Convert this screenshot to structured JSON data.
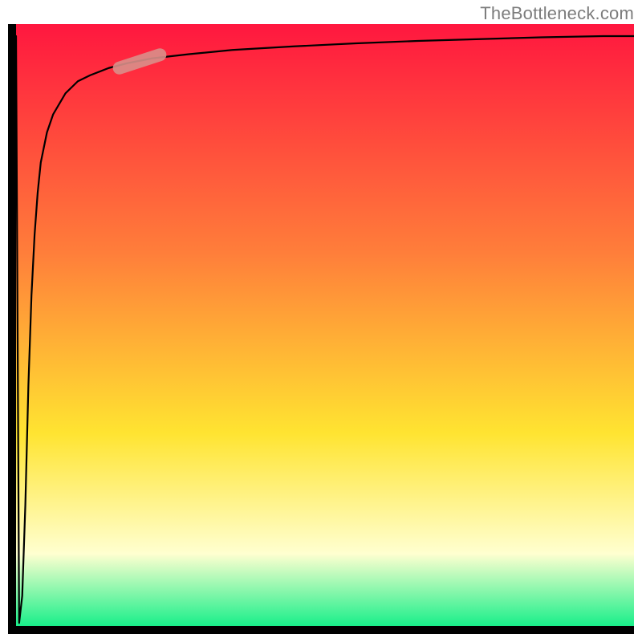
{
  "watermark": "TheBottleneck.com",
  "chart_data": {
    "type": "line",
    "title": "",
    "xlabel": "",
    "ylabel": "",
    "xlim": [
      0,
      100
    ],
    "ylim": [
      0,
      100
    ],
    "grid": false,
    "legend": false,
    "background_gradient": {
      "top": "#ff173f",
      "mid1": "#ff7e3a",
      "mid2": "#ffe431",
      "mid3": "#ffffd0",
      "bottom": "#19ef8a"
    },
    "series": [
      {
        "name": "curve",
        "color": "#000000",
        "stroke_width": 2.2,
        "x": [
          0.0,
          0.5,
          1.0,
          1.5,
          2.0,
          2.5,
          3.0,
          3.5,
          4.0,
          5.0,
          6.0,
          8.0,
          10.0,
          12.0,
          15.0,
          18.0,
          22.0,
          28.0,
          35.0,
          45.0,
          55.0,
          65.0,
          75.0,
          85.0,
          95.0,
          100.0
        ],
        "y": [
          98.0,
          0.5,
          5.0,
          20.0,
          40.0,
          55.0,
          65.0,
          72.0,
          77.0,
          82.0,
          85.0,
          88.5,
          90.5,
          91.5,
          92.7,
          93.5,
          94.3,
          95.0,
          95.7,
          96.3,
          96.8,
          97.2,
          97.5,
          97.8,
          98.0,
          98.0
        ]
      }
    ],
    "marker": {
      "name": "highlight-segment",
      "x_center": 20.0,
      "y_center": 93.8,
      "length_pct": 9.0,
      "angle_deg": 18,
      "color": "#d98f8a",
      "opacity": 0.9,
      "thickness": 16
    }
  }
}
